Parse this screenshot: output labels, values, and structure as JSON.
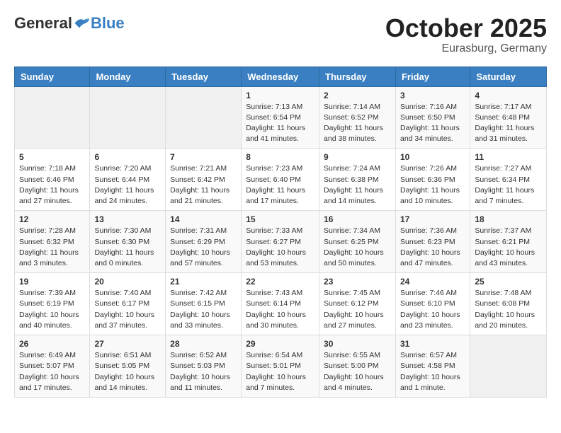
{
  "header": {
    "logo_general": "General",
    "logo_blue": "Blue",
    "month": "October 2025",
    "location": "Eurasburg, Germany"
  },
  "weekdays": [
    "Sunday",
    "Monday",
    "Tuesday",
    "Wednesday",
    "Thursday",
    "Friday",
    "Saturday"
  ],
  "weeks": [
    [
      {
        "day": "",
        "info": ""
      },
      {
        "day": "",
        "info": ""
      },
      {
        "day": "",
        "info": ""
      },
      {
        "day": "1",
        "info": "Sunrise: 7:13 AM\nSunset: 6:54 PM\nDaylight: 11 hours and 41 minutes."
      },
      {
        "day": "2",
        "info": "Sunrise: 7:14 AM\nSunset: 6:52 PM\nDaylight: 11 hours and 38 minutes."
      },
      {
        "day": "3",
        "info": "Sunrise: 7:16 AM\nSunset: 6:50 PM\nDaylight: 11 hours and 34 minutes."
      },
      {
        "day": "4",
        "info": "Sunrise: 7:17 AM\nSunset: 6:48 PM\nDaylight: 11 hours and 31 minutes."
      }
    ],
    [
      {
        "day": "5",
        "info": "Sunrise: 7:18 AM\nSunset: 6:46 PM\nDaylight: 11 hours and 27 minutes."
      },
      {
        "day": "6",
        "info": "Sunrise: 7:20 AM\nSunset: 6:44 PM\nDaylight: 11 hours and 24 minutes."
      },
      {
        "day": "7",
        "info": "Sunrise: 7:21 AM\nSunset: 6:42 PM\nDaylight: 11 hours and 21 minutes."
      },
      {
        "day": "8",
        "info": "Sunrise: 7:23 AM\nSunset: 6:40 PM\nDaylight: 11 hours and 17 minutes."
      },
      {
        "day": "9",
        "info": "Sunrise: 7:24 AM\nSunset: 6:38 PM\nDaylight: 11 hours and 14 minutes."
      },
      {
        "day": "10",
        "info": "Sunrise: 7:26 AM\nSunset: 6:36 PM\nDaylight: 11 hours and 10 minutes."
      },
      {
        "day": "11",
        "info": "Sunrise: 7:27 AM\nSunset: 6:34 PM\nDaylight: 11 hours and 7 minutes."
      }
    ],
    [
      {
        "day": "12",
        "info": "Sunrise: 7:28 AM\nSunset: 6:32 PM\nDaylight: 11 hours and 3 minutes."
      },
      {
        "day": "13",
        "info": "Sunrise: 7:30 AM\nSunset: 6:30 PM\nDaylight: 11 hours and 0 minutes."
      },
      {
        "day": "14",
        "info": "Sunrise: 7:31 AM\nSunset: 6:29 PM\nDaylight: 10 hours and 57 minutes."
      },
      {
        "day": "15",
        "info": "Sunrise: 7:33 AM\nSunset: 6:27 PM\nDaylight: 10 hours and 53 minutes."
      },
      {
        "day": "16",
        "info": "Sunrise: 7:34 AM\nSunset: 6:25 PM\nDaylight: 10 hours and 50 minutes."
      },
      {
        "day": "17",
        "info": "Sunrise: 7:36 AM\nSunset: 6:23 PM\nDaylight: 10 hours and 47 minutes."
      },
      {
        "day": "18",
        "info": "Sunrise: 7:37 AM\nSunset: 6:21 PM\nDaylight: 10 hours and 43 minutes."
      }
    ],
    [
      {
        "day": "19",
        "info": "Sunrise: 7:39 AM\nSunset: 6:19 PM\nDaylight: 10 hours and 40 minutes."
      },
      {
        "day": "20",
        "info": "Sunrise: 7:40 AM\nSunset: 6:17 PM\nDaylight: 10 hours and 37 minutes."
      },
      {
        "day": "21",
        "info": "Sunrise: 7:42 AM\nSunset: 6:15 PM\nDaylight: 10 hours and 33 minutes."
      },
      {
        "day": "22",
        "info": "Sunrise: 7:43 AM\nSunset: 6:14 PM\nDaylight: 10 hours and 30 minutes."
      },
      {
        "day": "23",
        "info": "Sunrise: 7:45 AM\nSunset: 6:12 PM\nDaylight: 10 hours and 27 minutes."
      },
      {
        "day": "24",
        "info": "Sunrise: 7:46 AM\nSunset: 6:10 PM\nDaylight: 10 hours and 23 minutes."
      },
      {
        "day": "25",
        "info": "Sunrise: 7:48 AM\nSunset: 6:08 PM\nDaylight: 10 hours and 20 minutes."
      }
    ],
    [
      {
        "day": "26",
        "info": "Sunrise: 6:49 AM\nSunset: 5:07 PM\nDaylight: 10 hours and 17 minutes."
      },
      {
        "day": "27",
        "info": "Sunrise: 6:51 AM\nSunset: 5:05 PM\nDaylight: 10 hours and 14 minutes."
      },
      {
        "day": "28",
        "info": "Sunrise: 6:52 AM\nSunset: 5:03 PM\nDaylight: 10 hours and 11 minutes."
      },
      {
        "day": "29",
        "info": "Sunrise: 6:54 AM\nSunset: 5:01 PM\nDaylight: 10 hours and 7 minutes."
      },
      {
        "day": "30",
        "info": "Sunrise: 6:55 AM\nSunset: 5:00 PM\nDaylight: 10 hours and 4 minutes."
      },
      {
        "day": "31",
        "info": "Sunrise: 6:57 AM\nSunset: 4:58 PM\nDaylight: 10 hours and 1 minute."
      },
      {
        "day": "",
        "info": ""
      }
    ]
  ]
}
